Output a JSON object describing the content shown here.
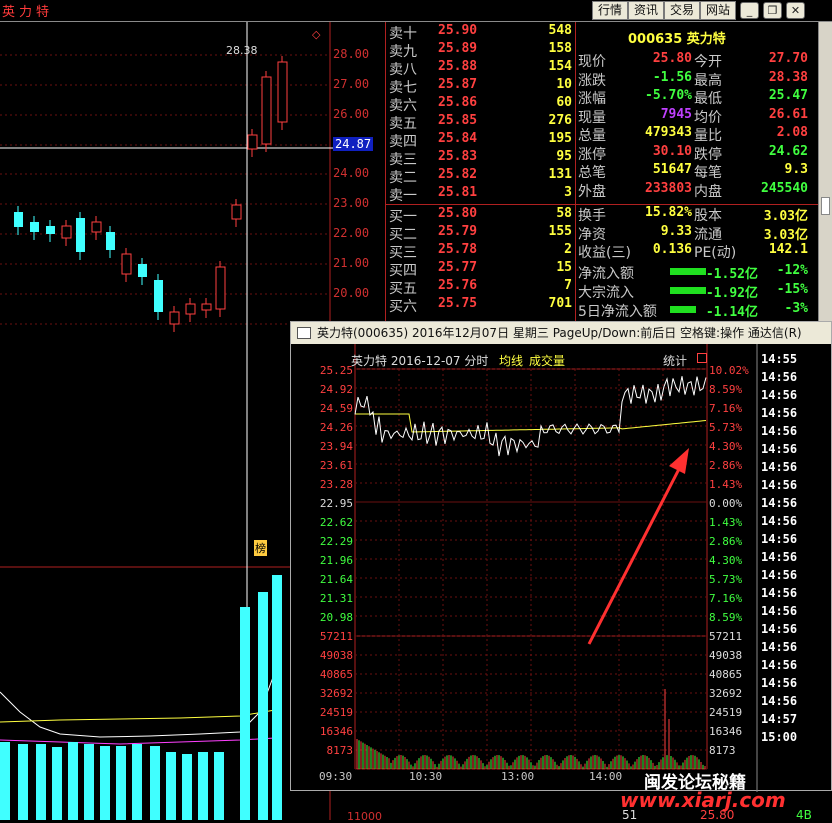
{
  "header": {
    "stock_title": "英力特"
  },
  "toolbar": {
    "buttons": [
      "行情",
      "资讯",
      "交易",
      "网站"
    ]
  },
  "kline": {
    "price_axis": [
      "28.00",
      "27.00",
      "26.00",
      "25.00",
      "24.00",
      "23.00",
      "22.00",
      "21.00",
      "20.00"
    ],
    "crosshair_price": "24.87",
    "high_label": "28.38",
    "rank_badge": "榜",
    "bottom_labels": [
      "11000",
      "51"
    ]
  },
  "order_book": {
    "sells": [
      {
        "label": "卖十",
        "price": "25.90",
        "vol": "548"
      },
      {
        "label": "卖九",
        "price": "25.89",
        "vol": "158"
      },
      {
        "label": "卖八",
        "price": "25.88",
        "vol": "154"
      },
      {
        "label": "卖七",
        "price": "25.87",
        "vol": "10"
      },
      {
        "label": "卖六",
        "price": "25.86",
        "vol": "60"
      },
      {
        "label": "卖五",
        "price": "25.85",
        "vol": "276"
      },
      {
        "label": "卖四",
        "price": "25.84",
        "vol": "195"
      },
      {
        "label": "卖三",
        "price": "25.83",
        "vol": "95"
      },
      {
        "label": "卖二",
        "price": "25.82",
        "vol": "131"
      },
      {
        "label": "卖一",
        "price": "25.81",
        "vol": "3"
      }
    ],
    "buys": [
      {
        "label": "买一",
        "price": "25.80",
        "vol": "58"
      },
      {
        "label": "买二",
        "price": "25.79",
        "vol": "155"
      },
      {
        "label": "买三",
        "price": "25.78",
        "vol": "2"
      },
      {
        "label": "买四",
        "price": "25.77",
        "vol": "15"
      },
      {
        "label": "买五",
        "price": "25.76",
        "vol": "7"
      },
      {
        "label": "买六",
        "price": "25.75",
        "vol": "701"
      }
    ]
  },
  "quote": {
    "code_name": "000635 英力特",
    "rows": [
      {
        "l1": "现价",
        "v1": "25.80",
        "c1": "#ff4040",
        "l2": "今开",
        "v2": "27.70",
        "c2": "#ff4040"
      },
      {
        "l1": "涨跌",
        "v1": "-1.56",
        "c1": "#40ff40",
        "l2": "最高",
        "v2": "28.38",
        "c2": "#ff4040"
      },
      {
        "l1": "涨幅",
        "v1": "-5.70%",
        "c1": "#40ff40",
        "l2": "最低",
        "v2": "25.47",
        "c2": "#40ff40"
      },
      {
        "l1": "现量",
        "v1": "7945",
        "c1": "#c040ff",
        "l2": "均价",
        "v2": "26.61",
        "c2": "#ff4040"
      },
      {
        "l1": "总量",
        "v1": "479343",
        "c1": "#ffff40",
        "l2": "量比",
        "v2": "2.08",
        "c2": "#ff4040"
      },
      {
        "l1": "涨停",
        "v1": "30.10",
        "c1": "#ff4040",
        "l2": "跌停",
        "v2": "24.62",
        "c2": "#40ff40"
      },
      {
        "l1": "总笔",
        "v1": "51647",
        "c1": "#ffff40",
        "l2": "每笔",
        "v2": "9.3",
        "c2": "#ffff40"
      },
      {
        "l1": "外盘",
        "v1": "233803",
        "c1": "#ff4040",
        "l2": "内盘",
        "v2": "245540",
        "c2": "#40ff40"
      }
    ],
    "rows2": [
      {
        "l1": "换手",
        "v1": "15.82%",
        "c1": "#ffff40",
        "l2": "股本",
        "v2": "3.03亿",
        "c2": "#ffff40"
      },
      {
        "l1": "净资",
        "v1": "9.33",
        "c1": "#ffff40",
        "l2": "流通",
        "v2": "3.03亿",
        "c2": "#ffff40"
      },
      {
        "l1": "收益(三)",
        "v1": "0.136",
        "c1": "#ffff40",
        "l2": "PE(动)",
        "v2": "142.1",
        "c2": "#ffff40"
      }
    ],
    "flows": [
      {
        "label": "净流入额",
        "value": "-1.52亿",
        "pct": "-12%"
      },
      {
        "label": "大宗流入",
        "value": "-1.92亿",
        "pct": "-15%"
      },
      {
        "label": "5日净流入额",
        "value": "-1.14亿",
        "pct": "-3%"
      }
    ]
  },
  "popup": {
    "title": "英力特(000635) 2016年12月07日 星期三 PageUp/Down:前后日 空格键:操作 通达信(R)",
    "chart_header": "英力特  2016-12-07 分时",
    "avg_label": "均线",
    "vol_label": "成交量",
    "stat_label": "统计",
    "price_ticks": [
      "25.25",
      "24.92",
      "24.59",
      "24.26",
      "23.94",
      "23.61",
      "23.28",
      "22.95",
      "22.62",
      "22.29",
      "21.96",
      "21.64",
      "21.31",
      "20.98"
    ],
    "pct_ticks": [
      "10.02%",
      "8.59%",
      "7.16%",
      "5.73%",
      "4.30%",
      "2.86%",
      "1.43%",
      "0.00%",
      "1.43%",
      "2.86%",
      "4.30%",
      "5.73%",
      "7.16%",
      "8.59%"
    ],
    "vol_ticks": [
      "57211",
      "49038",
      "40865",
      "32692",
      "24519",
      "16346",
      "8173"
    ],
    "time_ticks": [
      "09:30",
      "10:30",
      "13:00",
      "14:00"
    ],
    "tick_times": [
      "14:55",
      "14:56",
      "14:56",
      "14:56",
      "14:56",
      "14:56",
      "14:56",
      "14:56",
      "14:56",
      "14:56",
      "14:56",
      "14:56",
      "14:56",
      "14:56",
      "14:56",
      "14:56",
      "14:56",
      "14:56",
      "14:56",
      "14:56",
      "14:57",
      "15:00"
    ]
  },
  "watermark": {
    "text": "闽发论坛秘籍",
    "url": "www.xiarj.com"
  },
  "bottom_right": {
    "price": "25.80",
    "vol": "4B"
  },
  "colors": {
    "up": "#ff4040",
    "down": "#40ff40",
    "grid": "#b02020",
    "accent": "#ffff40",
    "volume": "#40ffff"
  }
}
